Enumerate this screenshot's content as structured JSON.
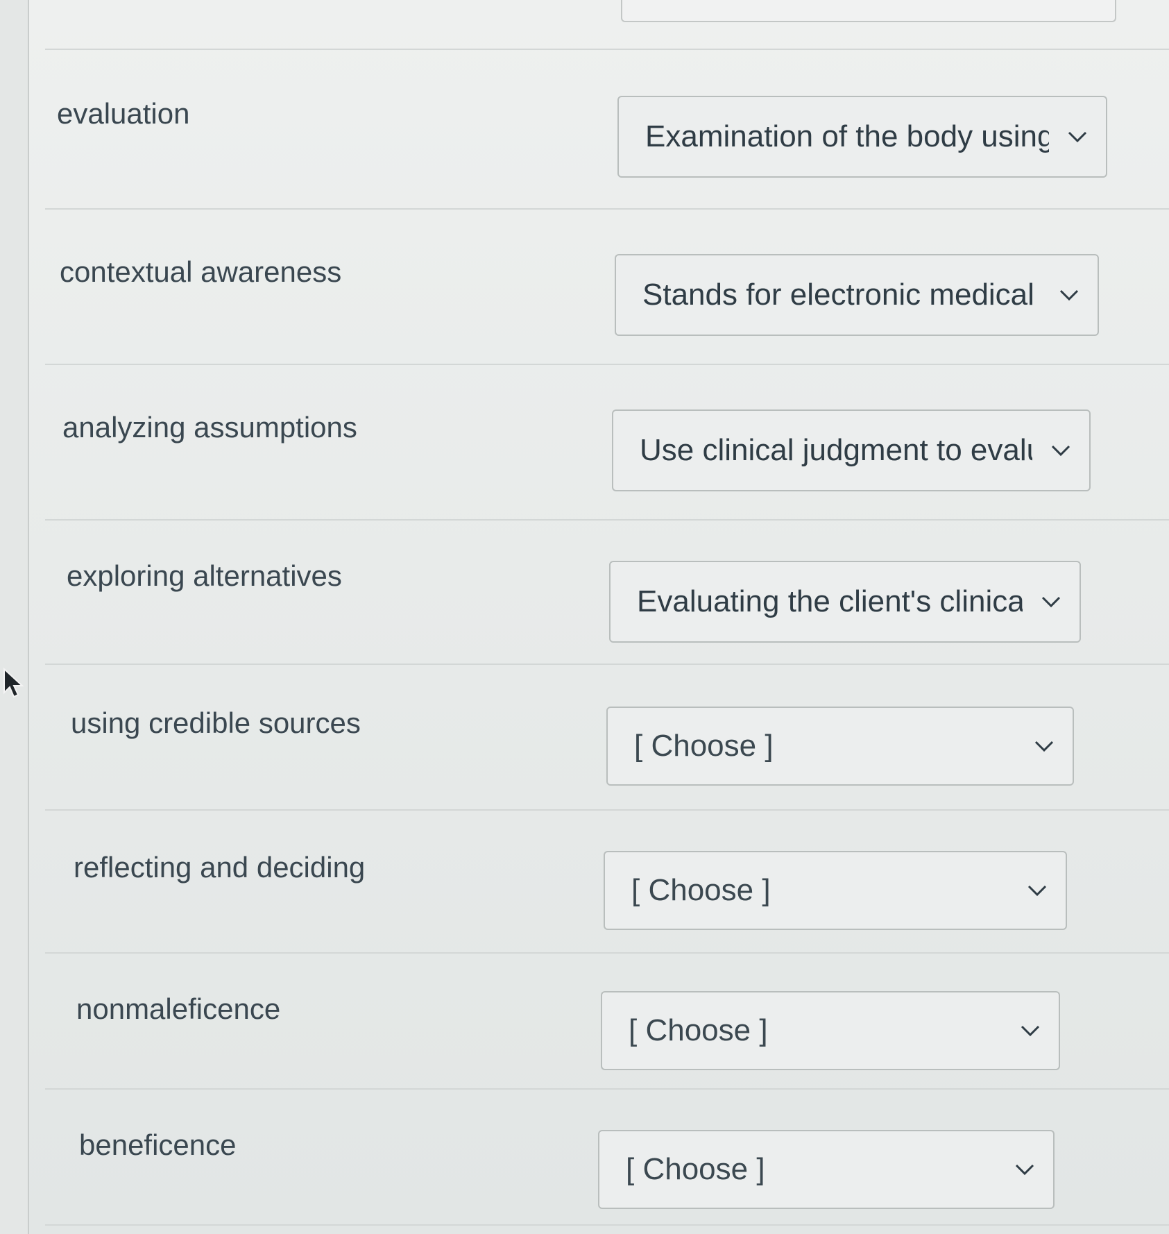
{
  "rows": [
    {
      "term": "evaluation",
      "selected": "Examination of the body using",
      "chevron_icon": "chevron-down-icon"
    },
    {
      "term": "contextual awareness",
      "selected": "Stands for electronic medical r",
      "chevron_icon": "chevron-down-icon"
    },
    {
      "term": "analyzing assumptions",
      "selected": "Use clinical judgment to evalu",
      "chevron_icon": "chevron-down-icon"
    },
    {
      "term": "exploring alternatives",
      "selected": "Evaluating the client's clinical",
      "chevron_icon": "chevron-down-icon"
    },
    {
      "term": "using credible sources",
      "selected": "[ Choose ]",
      "chevron_icon": "chevron-down-icon"
    },
    {
      "term": "reflecting and deciding",
      "selected": "[ Choose ]",
      "chevron_icon": "chevron-down-icon"
    },
    {
      "term": "nonmaleficence",
      "selected": "[ Choose ]",
      "chevron_icon": "chevron-down-icon"
    },
    {
      "term": "beneficence",
      "selected": "[ Choose ]",
      "chevron_icon": "chevron-down-icon"
    }
  ],
  "colors": {
    "text": "#2d3b45",
    "border": "#b9bebd",
    "background": "#e9eceb"
  }
}
